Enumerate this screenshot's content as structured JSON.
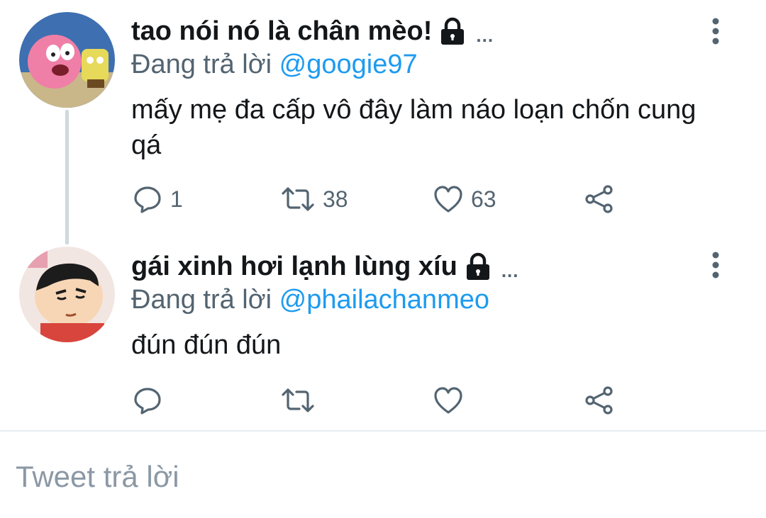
{
  "tweets": [
    {
      "author": "tao nói nó là chân mèo!",
      "ellipsis": "...",
      "reply_prefix": "Đang trả lời",
      "reply_handle": "@googie97",
      "text": "mấy mẹ đa cấp vô đây làm náo loạn chốn cung qá",
      "counts": {
        "reply": "1",
        "retweet": "38",
        "like": "63"
      }
    },
    {
      "author": "gái xinh hơi lạnh lùng xíu",
      "ellipsis": "...",
      "reply_prefix": "Đang trả lời",
      "reply_handle": "@phailachanmeo",
      "text": "đún đún đún",
      "counts": {
        "reply": "",
        "retweet": "",
        "like": ""
      }
    }
  ],
  "compose": {
    "placeholder": "Tweet trả lời"
  },
  "icons": {
    "protected": "lock-icon",
    "more": "more-vertical-icon",
    "reply": "reply-icon",
    "retweet": "retweet-icon",
    "like": "heart-icon",
    "share": "share-icon"
  },
  "colors": {
    "text": "#14171a",
    "secondary": "#536471",
    "link": "#1d9bf0",
    "divider": "#e6ecf0",
    "placeholder": "#8b98a5"
  }
}
